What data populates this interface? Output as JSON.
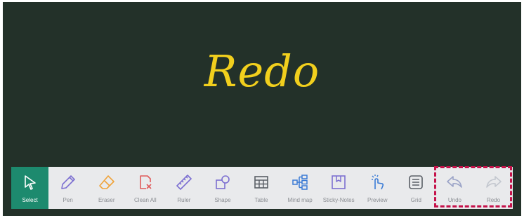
{
  "canvas": {
    "title": "Redo"
  },
  "toolbar": {
    "tools": [
      {
        "label": "Select",
        "icon": "cursor-icon",
        "active": true
      },
      {
        "label": "Pen",
        "icon": "pen-icon"
      },
      {
        "label": "Eraser",
        "icon": "eraser-icon"
      },
      {
        "label": "Clean All",
        "icon": "clean-all-icon"
      },
      {
        "label": "Ruler",
        "icon": "ruler-icon"
      },
      {
        "label": "Shape",
        "icon": "shape-icon"
      },
      {
        "label": "Table",
        "icon": "table-icon"
      },
      {
        "label": "Mind map",
        "icon": "mind-map-icon"
      },
      {
        "label": "Sticky-Notes",
        "icon": "sticky-notes-icon"
      },
      {
        "label": "Preview",
        "icon": "preview-icon"
      },
      {
        "label": "Grid",
        "icon": "grid-icon"
      },
      {
        "label": "Undo",
        "icon": "undo-icon"
      },
      {
        "label": "Redo",
        "icon": "redo-icon"
      }
    ]
  },
  "colors": {
    "board": "#233129",
    "title": "#f1cf1d",
    "active_tool": "#1d8a6e",
    "icon_purple": "#7c6fd1",
    "icon_orange": "#f0a33a",
    "icon_red": "#e05a5a",
    "highlight": "#c5124a"
  }
}
